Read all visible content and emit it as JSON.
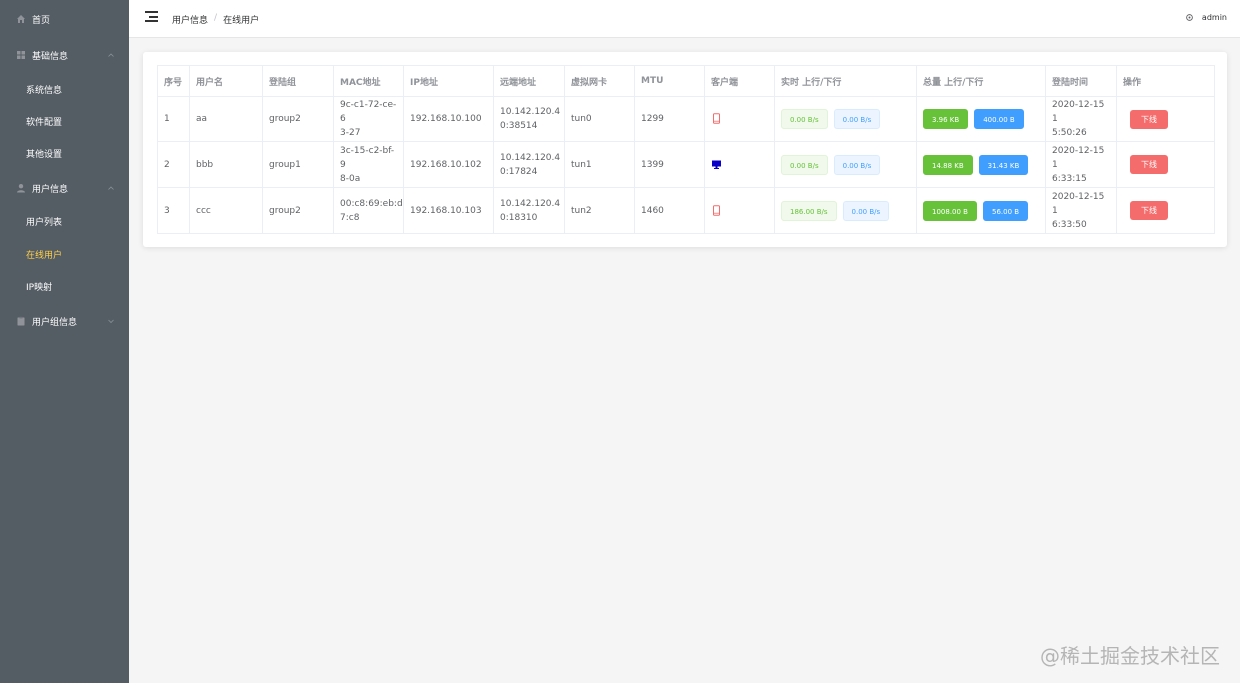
{
  "sidebar": {
    "items": [
      {
        "label": "首页",
        "icon": "home-icon"
      },
      {
        "label": "基础信息",
        "icon": "grid-icon"
      },
      {
        "label": "系统信息"
      },
      {
        "label": "软件配置"
      },
      {
        "label": "其他设置"
      },
      {
        "label": "用户信息",
        "icon": "user-icon"
      },
      {
        "label": "用户列表"
      },
      {
        "label": "在线用户"
      },
      {
        "label": "IP映射"
      },
      {
        "label": "用户组信息",
        "icon": "clipboard-icon"
      }
    ],
    "active_color": "#ffd04b",
    "bg_color": "#545c64"
  },
  "header": {
    "breadcrumb": [
      "用户信息",
      "/",
      "在线用户"
    ],
    "user": "admin"
  },
  "table": {
    "columns": [
      "序号",
      "用户名",
      "登陆组",
      "MAC地址",
      "IP地址",
      "远端地址",
      "虚拟网卡",
      "MTU",
      "客户端",
      "实时 上行/下行",
      "总量 上行/下行",
      "登陆时间",
      "操作"
    ],
    "rows": [
      {
        "idx": "1",
        "user": "aa",
        "group": "group2",
        "mac": "9c-c1-72-ce-6",
        "mac2": "3-27",
        "ip": "192.168.10.100",
        "remote": "10.142.120.4",
        "remote2": "0:38514",
        "tun": "tun0",
        "mtu": "1299",
        "client": "phone-icon",
        "rt_up": "0.00 B/s",
        "rt_down": "0.00 B/s",
        "tot_up": "3.96 KB",
        "tot_down": "400.00 B",
        "time": "2020-12-15 1",
        "time2": "5:50:26",
        "action": "下线"
      },
      {
        "idx": "2",
        "user": "bbb",
        "group": "group1",
        "mac": "3c-15-c2-bf-9",
        "mac2": "8-0a",
        "ip": "192.168.10.102",
        "remote": "10.142.120.4",
        "remote2": "0:17824",
        "tun": "tun1",
        "mtu": "1399",
        "client": "monitor-icon",
        "rt_up": "0.00 B/s",
        "rt_down": "0.00 B/s",
        "tot_up": "14.88 KB",
        "tot_down": "31.43 KB",
        "time": "2020-12-15 1",
        "time2": "6:33:15",
        "action": "下线"
      },
      {
        "idx": "3",
        "user": "ccc",
        "group": "group2",
        "mac": "00:c8:69:eb:d",
        "mac2": "7:c8",
        "ip": "192.168.10.103",
        "remote": "10.142.120.4",
        "remote2": "0:18310",
        "tun": "tun2",
        "mtu": "1460",
        "client": "phone-icon",
        "rt_up": "186.00 B/s",
        "rt_down": "0.00 B/s",
        "tot_up": "1008.00 B",
        "tot_down": "56.00 B",
        "time": "2020-12-15 1",
        "time2": "6:33:50",
        "action": "下线"
      }
    ]
  },
  "watermark": "@稀土掘金技术社区"
}
